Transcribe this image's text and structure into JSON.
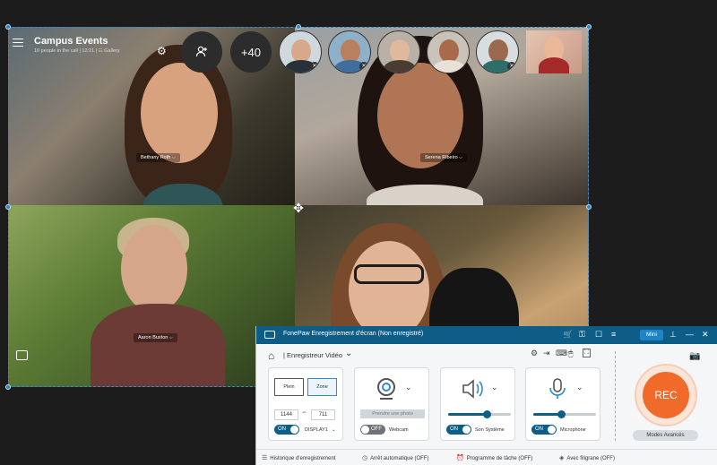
{
  "meeting": {
    "title": "Campus Events",
    "subtitle": "10 people in the call | 12:21 | ☷ Gallery",
    "more_count": "+40"
  },
  "participants": [
    {
      "name": "Bethany Roth"
    },
    {
      "name": "Serena Ribeiro"
    },
    {
      "name": "Aaron Buxton"
    }
  ],
  "capture": {
    "width": "1144",
    "height": "711"
  },
  "recorder": {
    "app_title": "FonePaw Enregistrement d'écran (Non enregistré)",
    "mini_label": "Mini",
    "mode_label": "| Enregistreur Vidéo",
    "area_full": "Plein",
    "area_zone": "Zone",
    "display_toggle": "ON",
    "display_label": "DISPLAY1",
    "webcam_photo": "Prendre une photo",
    "webcam_toggle": "OFF",
    "webcam_label": "Webcam",
    "system_toggle": "ON",
    "system_label": "Son Système",
    "system_volume": 0.62,
    "mic_toggle": "ON",
    "mic_label": "Microphone",
    "mic_volume": 0.45,
    "rec_label": "REC",
    "advanced_label": "Modes Avancés",
    "status": {
      "history": "Historique d'enregistrement",
      "auto_stop": "Arrêt automatique (OFF)",
      "schedule": "Programme de tâche (OFF)",
      "watermark": "Avec filigrane (OFF)"
    }
  },
  "colors": {
    "accent": "#0d5d86",
    "rec": "#f06a2a",
    "selection": "#2e8bd0"
  }
}
